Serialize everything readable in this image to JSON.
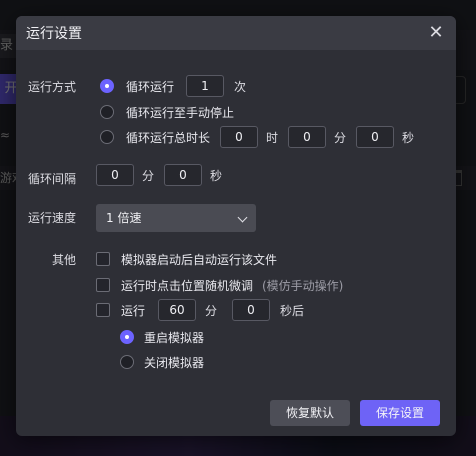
{
  "background": {
    "tab_text": "录",
    "button_text": "开",
    "row_text": "游戏",
    "mark": "≈"
  },
  "dialog": {
    "title": "运行设置",
    "close_icon": "close-icon",
    "run_mode": {
      "label": "运行方式",
      "options": [
        {
          "label": "循环运行",
          "selected": true,
          "value": "1",
          "unit": "次"
        },
        {
          "label": "循环运行至手动停止",
          "selected": false
        },
        {
          "label": "循环运行总时长",
          "selected": false,
          "hours": "0",
          "hours_unit": "时",
          "minutes": "0",
          "minutes_unit": "分",
          "seconds": "0",
          "seconds_unit": "秒"
        }
      ]
    },
    "interval": {
      "label": "循环间隔",
      "minutes": "0",
      "minutes_unit": "分",
      "seconds": "0",
      "seconds_unit": "秒"
    },
    "speed": {
      "label": "运行速度",
      "value": "1 倍速"
    },
    "other": {
      "label": "其他",
      "autorun": {
        "label": "模拟器启动后自动运行该文件",
        "checked": false
      },
      "jitter": {
        "label": "运行时点击位置随机微调",
        "note": "(模仿手动操作)",
        "checked": false
      },
      "timed": {
        "checked": false,
        "prefix": "运行",
        "minutes": "60",
        "minutes_unit": "分",
        "seconds": "0",
        "seconds_unit": "秒后",
        "actions": [
          {
            "label": "重启模拟器",
            "selected": true
          },
          {
            "label": "关闭模拟器",
            "selected": false
          }
        ]
      }
    },
    "buttons": {
      "reset": "恢复默认",
      "save": "保存设置"
    }
  },
  "colors": {
    "accent": "#6e63f6",
    "dialog_bg": "#2e2f36",
    "titlebar_bg": "#3a3b43"
  }
}
